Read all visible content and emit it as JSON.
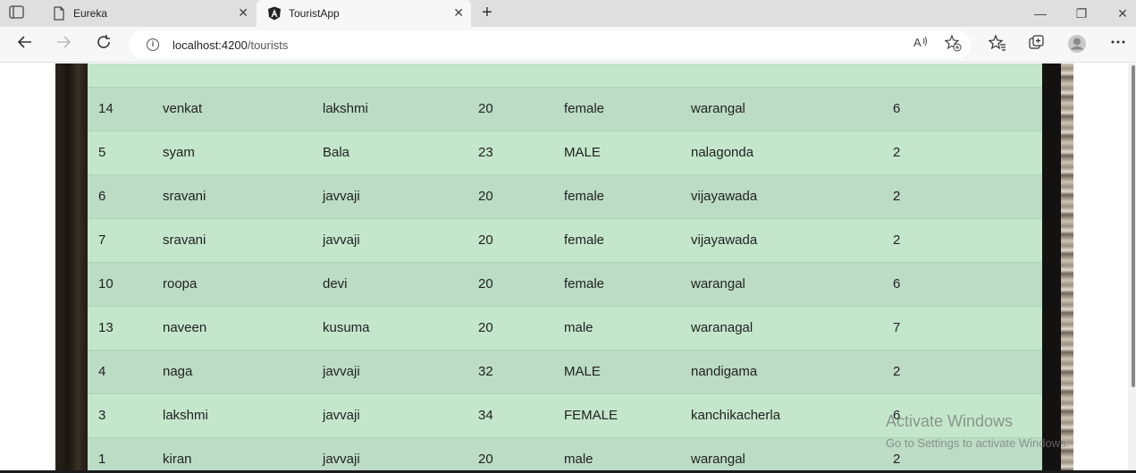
{
  "browser": {
    "tabs": [
      {
        "title": "Eureka",
        "icon": "page-icon",
        "active": false
      },
      {
        "title": "TouristApp",
        "icon": "angular-icon",
        "active": true
      }
    ],
    "address": {
      "host": "localhost:4200",
      "path": "/tourists"
    },
    "buttons": {
      "close_tab": "✕",
      "new_tab": "+",
      "minimize": "—",
      "restore": "❐",
      "close": "✕"
    }
  },
  "tourists": [
    {
      "id": "14",
      "first_name": "venkat",
      "last_name": "lakshmi",
      "age": "20",
      "gender": "female",
      "city": "warangal",
      "days": "6"
    },
    {
      "id": "5",
      "first_name": "syam",
      "last_name": "Bala",
      "age": "23",
      "gender": "MALE",
      "city": "nalagonda",
      "days": "2"
    },
    {
      "id": "6",
      "first_name": "sravani",
      "last_name": "javvaji",
      "age": "20",
      "gender": "female",
      "city": "vijayawada",
      "days": "2"
    },
    {
      "id": "7",
      "first_name": "sravani",
      "last_name": "javvaji",
      "age": "20",
      "gender": "female",
      "city": "vijayawada",
      "days": "2"
    },
    {
      "id": "10",
      "first_name": "roopa",
      "last_name": "devi",
      "age": "20",
      "gender": "female",
      "city": "warangal",
      "days": "6"
    },
    {
      "id": "13",
      "first_name": "naveen",
      "last_name": "kusuma",
      "age": "20",
      "gender": "male",
      "city": "waranagal",
      "days": "7"
    },
    {
      "id": "4",
      "first_name": "naga",
      "last_name": "javvaji",
      "age": "32",
      "gender": "MALE",
      "city": "nandigama",
      "days": "2"
    },
    {
      "id": "3",
      "first_name": "lakshmi",
      "last_name": "javvaji",
      "age": "34",
      "gender": "FEMALE",
      "city": "kanchikacherla",
      "days": "6"
    },
    {
      "id": "1",
      "first_name": "kiran",
      "last_name": "javvaji",
      "age": "20",
      "gender": "male",
      "city": "warangal",
      "days": "2"
    }
  ],
  "watermark": {
    "line1": "Activate Windows",
    "line2": "Go to Settings to activate Windows."
  },
  "colors": {
    "row_odd": "#bcdcc5",
    "row_even": "#c4e7cc"
  }
}
